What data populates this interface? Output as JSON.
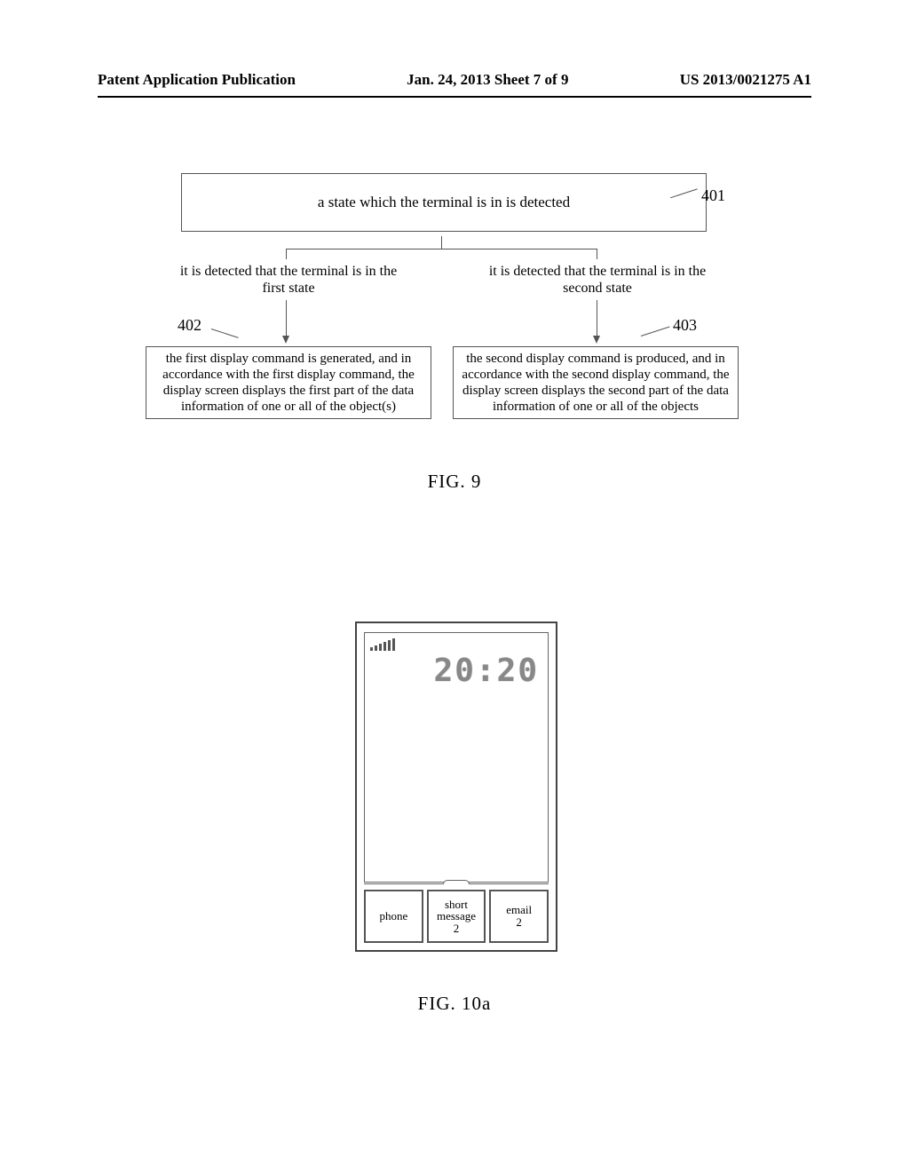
{
  "header": {
    "left": "Patent Application Publication",
    "center": "Jan. 24, 2013  Sheet 7 of 9",
    "right": "US 2013/0021275 A1"
  },
  "flowchart": {
    "box1": "a state which the terminal is in is detected",
    "ref401": "401",
    "branch_left": "it is detected that the terminal is in the first state",
    "branch_right": "it is detected that the terminal is in the second state",
    "ref402": "402",
    "ref403": "403",
    "box2": "the first display command is generated, and in accordance with the first display command, the display screen displays the first part of the data information of one or all of the object(s)",
    "box3": "the second display command is produced, and in accordance with the second display command, the display screen displays the second part of the data information of one or all of the objects"
  },
  "fig9_label": "FIG. 9",
  "phone": {
    "clock": "20:20",
    "dock": [
      {
        "label": "phone",
        "count": ""
      },
      {
        "label": "short message",
        "count": "2"
      },
      {
        "label": "email",
        "count": "2"
      }
    ]
  },
  "fig10a_label": "FIG. 10a"
}
